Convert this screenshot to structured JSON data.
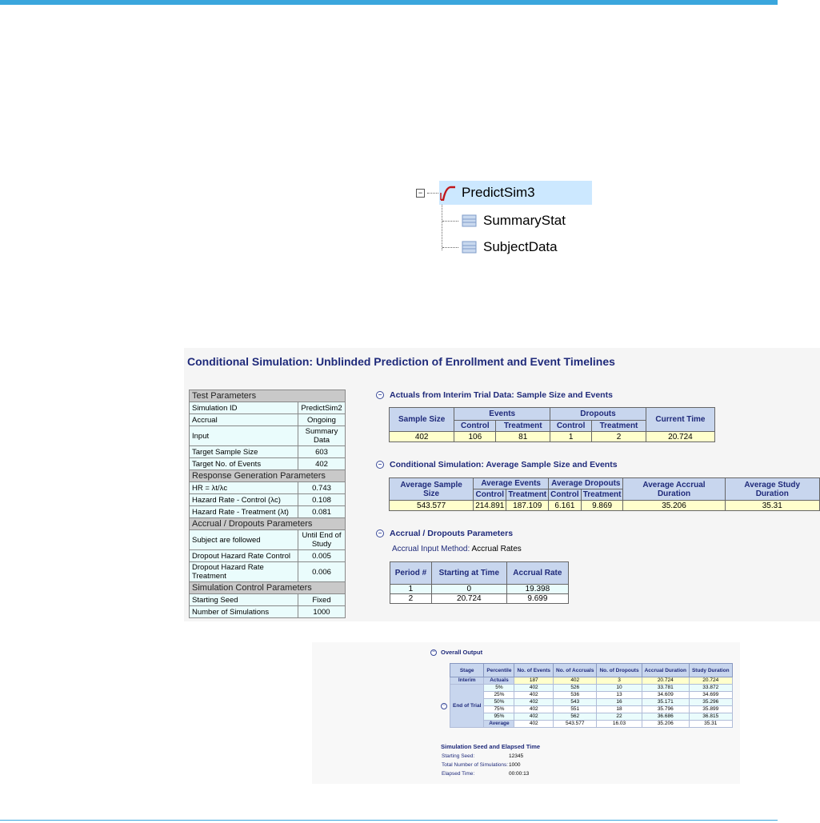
{
  "tree": {
    "root": "PredictSim3",
    "children": [
      "SummaryStat",
      "SubjectData"
    ]
  },
  "report": {
    "title": "Conditional Simulation: Unblinded Prediction of Enrollment and Event Timelines",
    "params": [
      {
        "type": "header",
        "label": "Test Parameters"
      },
      {
        "label": "Simulation ID",
        "value": "PredictSim2"
      },
      {
        "label": "Accrual",
        "value": "Ongoing"
      },
      {
        "label": "Input",
        "value": "Summary Data"
      },
      {
        "label": "Target Sample Size",
        "value": "603"
      },
      {
        "label": "Target No. of Events",
        "value": "402"
      },
      {
        "type": "header",
        "label": "Response Generation Parameters"
      },
      {
        "label": "HR = λt/λc",
        "value": "0.743"
      },
      {
        "label": "Hazard Rate - Control (λc)",
        "value": "0.108"
      },
      {
        "label": "Hazard Rate - Treatment (λt)",
        "value": "0.081"
      },
      {
        "type": "header",
        "label": "Accrual / Dropouts Parameters"
      },
      {
        "label": "Subject are followed",
        "value": "Until End of Study"
      },
      {
        "label": "Dropout Hazard Rate Control",
        "value": "0.005"
      },
      {
        "label": "Dropout Hazard Rate Treatment",
        "value": "0.006"
      },
      {
        "type": "header",
        "label": "Simulation Control Parameters"
      },
      {
        "label": "Starting Seed",
        "value": "Fixed"
      },
      {
        "label": "Number of Simulations",
        "value": "1000"
      }
    ],
    "actuals": {
      "heading": "Actuals from Interim Trial Data: Sample Size and Events",
      "h": {
        "sample_size": "Sample Size",
        "events": "Events",
        "dropouts": "Dropouts",
        "current_time": "Current Time",
        "control": "Control",
        "treatment": "Treatment"
      },
      "row": [
        "402",
        "106",
        "81",
        "1",
        "2",
        "20.724"
      ]
    },
    "conditional": {
      "heading": "Conditional Simulation: Average Sample Size and Events",
      "h": {
        "avg_sample": "Average Sample Size",
        "avg_events": "Average Events",
        "avg_dropouts": "Average Dropouts",
        "avg_accrual": "Average Accrual Duration",
        "avg_study": "Average Study Duration",
        "control": "Control",
        "treatment": "Treatment"
      },
      "row": [
        "543.577",
        "214.891",
        "187.109",
        "6.161",
        "9.869",
        "35.206",
        "35.31"
      ]
    },
    "accrual": {
      "heading": "Accrual / Dropouts Parameters",
      "method_label": "Accrual Input Method:",
      "method_value": "Accrual Rates",
      "h": {
        "period": "Period #",
        "starting": "Starting at Time",
        "rate": "Accrual Rate"
      },
      "rows": [
        [
          "1",
          "0",
          "19.398"
        ],
        [
          "2",
          "20.724",
          "9.699"
        ]
      ]
    }
  },
  "overall": {
    "heading": "Overall Output",
    "h": [
      "Stage",
      "Percentile",
      "No. of Events",
      "No. of Accruals",
      "No. of Dropouts",
      "Accrual Duration",
      "Study Duration"
    ],
    "interim": [
      "Interim",
      "Actuals",
      "187",
      "402",
      "3",
      "20.724",
      "20.724"
    ],
    "end_label": "End of Trial",
    "end_rows": [
      [
        "5%",
        "402",
        "526",
        "10",
        "33.781",
        "33.872"
      ],
      [
        "25%",
        "402",
        "536",
        "13",
        "34.609",
        "34.699"
      ],
      [
        "50%",
        "402",
        "543",
        "16",
        "35.171",
        "35.296"
      ],
      [
        "75%",
        "402",
        "551",
        "18",
        "35.796",
        "35.899"
      ],
      [
        "95%",
        "402",
        "562",
        "22",
        "36.686",
        "36.815"
      ]
    ],
    "average": [
      "Average",
      "402",
      "543.577",
      "16.03",
      "35.206",
      "35.31"
    ],
    "seed_heading": "Simulation Seed and Elapsed Time",
    "seed_rows": [
      {
        "label": "Starting Seed:",
        "value": "12345"
      },
      {
        "label": "Total Number of Simulations:",
        "value": "1000"
      },
      {
        "label": "Elapsed Time:",
        "value": "00:00:13"
      }
    ]
  },
  "colors": {
    "accent": "#3aa6dd",
    "title": "#1f2a7a",
    "header_fill": "#c8d6ee",
    "value_fill": "#ffffcc",
    "param_fill": "#eafcfc"
  }
}
